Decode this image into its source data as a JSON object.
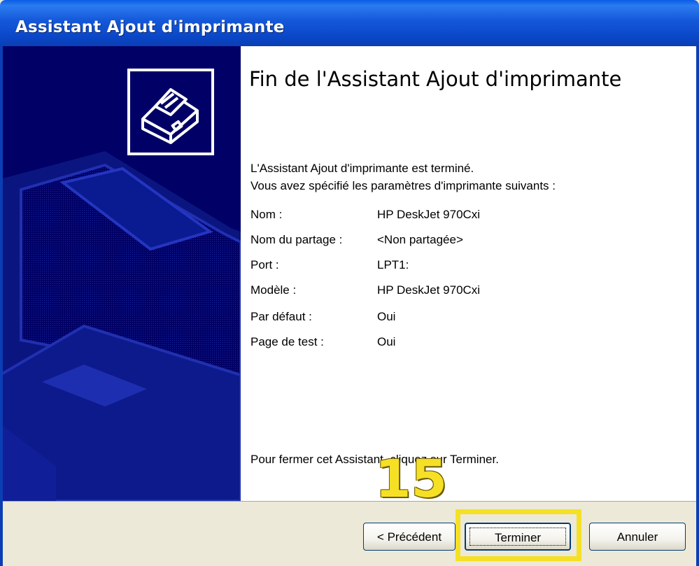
{
  "window": {
    "title": "Assistant Ajout d'imprimante"
  },
  "heading": "Fin de l'Assistant Ajout d'imprimante",
  "intro": {
    "line1": "L'Assistant Ajout d'imprimante est terminé.",
    "line2": "Vous avez spécifié les paramètres d'imprimante suivants :"
  },
  "settings": [
    {
      "label": "Nom :",
      "value": "HP DeskJet 970Cxi"
    },
    {
      "label": "Nom du partage :",
      "value": "<Non partagée>"
    },
    {
      "label": "Port :",
      "value": "LPT1:"
    },
    {
      "label": "Modèle :",
      "value": "HP DeskJet 970Cxi"
    },
    {
      "label": "Par défaut :",
      "value": "Oui"
    },
    {
      "label": "Page de test :",
      "value": "Oui"
    }
  ],
  "footer_text": "Pour fermer cet Assistant, cliquez sur Terminer.",
  "buttons": {
    "back_label": "< Précédent",
    "finish_label": "Terminer",
    "cancel_label": "Annuler"
  },
  "annotation": {
    "step_number": "15",
    "color": "#f5e025"
  },
  "colors": {
    "titlebar": "#0a47c8",
    "left_panel": "#000066",
    "dialog_bg": "#ece9d8"
  },
  "icons": {
    "wizard_icon": "printer-icon"
  }
}
